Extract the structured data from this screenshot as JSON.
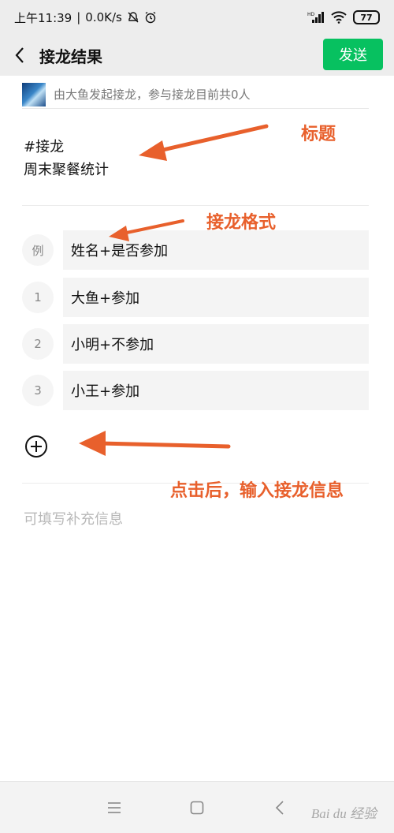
{
  "status_bar": {
    "time": "上午11:39",
    "speed": "0.0K/s",
    "battery": "77",
    "icons": [
      "mute-icon",
      "alarm-icon",
      "signal-icon",
      "wifi-icon",
      "battery-icon"
    ]
  },
  "nav": {
    "title": "接龙结果",
    "send_label": "发送",
    "back_icon": "chevron-left-icon"
  },
  "initiator": {
    "text": "由大鱼发起接龙，参与接龙目前共0人"
  },
  "title_block": {
    "line1": "#接龙",
    "line2": "周末聚餐统计"
  },
  "example": {
    "index": "例",
    "text": "姓名+是否参加"
  },
  "entries": [
    {
      "index": "1",
      "text": "大鱼+参加"
    },
    {
      "index": "2",
      "text": "小明+不参加"
    },
    {
      "index": "3",
      "text": "小王+参加"
    }
  ],
  "add_icon": "plus-circle-icon",
  "extra_placeholder": "可填写补充信息",
  "annotations": {
    "title": "标题",
    "format": "接龙格式",
    "hint": "点击后，输入接龙信息"
  },
  "bottom_nav": {
    "icons": [
      "menu-icon",
      "home-square-icon",
      "back-chevron-icon"
    ]
  },
  "watermark": "Bai du 经验",
  "colors": {
    "send_button": "#07c160",
    "annotation": "#e8602c",
    "header_bg": "#ededed"
  }
}
